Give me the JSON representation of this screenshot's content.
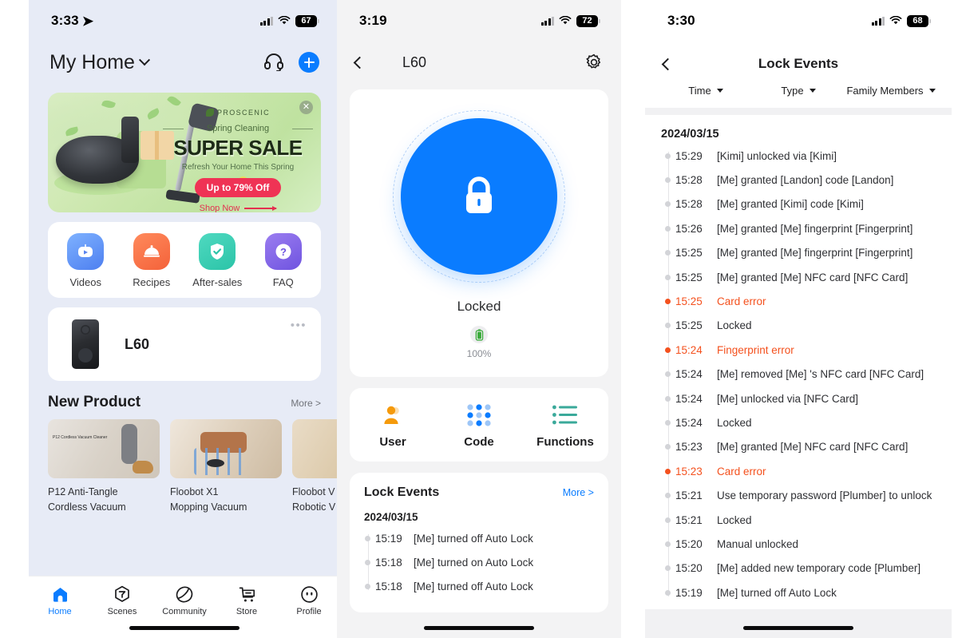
{
  "panel1": {
    "status": {
      "time": "3:33",
      "battery": "67",
      "location_icon": "location-arrow-icon",
      "wifi_icon": "wifi-icon",
      "signal_icon": "cellular-signal-icon"
    },
    "header": {
      "title": "My Home",
      "chevron_icon": "chevron-down-icon",
      "support_icon": "headset-icon",
      "add_icon": "plus-icon"
    },
    "banner": {
      "brand": "PROSCENIC",
      "eyebrow": "Spring Cleaning",
      "headline": "SUPER SALE",
      "tagline": "Refresh Your Home This Spring",
      "badge": "Up to 79% Off",
      "cta": "Shop Now",
      "close_icon": "close-icon"
    },
    "quick_actions": [
      {
        "label": "Videos",
        "icon": "play-video-icon"
      },
      {
        "label": "Recipes",
        "icon": "food-cover-icon"
      },
      {
        "label": "After-sales",
        "icon": "shield-check-icon"
      },
      {
        "label": "FAQ",
        "icon": "question-mark-icon"
      }
    ],
    "device": {
      "name": "L60",
      "more_icon": "more-dots-icon",
      "image": "smart-lock-image"
    },
    "new_product": {
      "title": "New Product",
      "more": "More >",
      "items": [
        {
          "name": "P12 Anti-Tangle\nCordless Vacuum",
          "caption": "P12 Cordless Vacuum Cleaner"
        },
        {
          "name": "Floobot X1\nMopping Vacuum",
          "caption": ""
        },
        {
          "name": "Floobot V\nRobotic V",
          "caption": ""
        }
      ]
    },
    "tabs": [
      {
        "label": "Home",
        "icon": "home-icon",
        "active": true
      },
      {
        "label": "Scenes",
        "icon": "scenes-icon",
        "active": false
      },
      {
        "label": "Community",
        "icon": "community-icon",
        "active": false
      },
      {
        "label": "Store",
        "icon": "cart-icon",
        "active": false
      },
      {
        "label": "Profile",
        "icon": "profile-icon",
        "active": false
      }
    ]
  },
  "panel2": {
    "status": {
      "time": "3:19",
      "battery": "72"
    },
    "header": {
      "title": "L60",
      "back_icon": "chevron-left-icon",
      "settings_icon": "gear-icon"
    },
    "lock": {
      "state": "Locked",
      "lock_icon": "padlock-closed-icon",
      "battery_percent": "100%",
      "battery_icon": "battery-full-icon"
    },
    "functions": [
      {
        "label": "User",
        "icon": "user-icon"
      },
      {
        "label": "Code",
        "icon": "keypad-dots-icon"
      },
      {
        "label": "Functions",
        "icon": "list-icon"
      }
    ],
    "events_card": {
      "title": "Lock Events",
      "more": "More >",
      "date": "2024/03/15",
      "rows": [
        {
          "time": "15:19",
          "text": "[Me] turned off Auto Lock",
          "error": false
        },
        {
          "time": "15:18",
          "text": "[Me] turned on Auto Lock",
          "error": false
        },
        {
          "time": "15:18",
          "text": "[Me] turned off Auto Lock",
          "error": false
        }
      ]
    }
  },
  "panel3": {
    "status": {
      "time": "3:30",
      "battery": "68"
    },
    "header": {
      "title": "Lock Events",
      "back_icon": "chevron-left-icon"
    },
    "filters": [
      {
        "label": "Time",
        "icon": "caret-down-icon"
      },
      {
        "label": "Type",
        "icon": "caret-down-icon"
      },
      {
        "label": "Family Members",
        "icon": "caret-down-icon"
      }
    ],
    "date": "2024/03/15",
    "events": [
      {
        "time": "15:29",
        "text": "[Kimi] unlocked via [Kimi]",
        "error": false
      },
      {
        "time": "15:28",
        "text": "[Me] granted [Landon] code [Landon]",
        "error": false
      },
      {
        "time": "15:28",
        "text": "[Me] granted [Kimi] code [Kimi]",
        "error": false
      },
      {
        "time": "15:26",
        "text": "[Me] granted [Me] fingerprint [Fingerprint]",
        "error": false
      },
      {
        "time": "15:25",
        "text": "[Me] granted [Me] fingerprint [Fingerprint]",
        "error": false
      },
      {
        "time": "15:25",
        "text": "[Me] granted [Me] NFC card [NFC Card]",
        "error": false
      },
      {
        "time": "15:25",
        "text": "Card error",
        "error": true
      },
      {
        "time": "15:25",
        "text": "Locked",
        "error": false
      },
      {
        "time": "15:24",
        "text": "Fingerprint error",
        "error": true
      },
      {
        "time": "15:24",
        "text": "[Me] removed [Me] 's NFC card [NFC Card]",
        "error": false
      },
      {
        "time": "15:24",
        "text": "[Me] unlocked via [NFC Card]",
        "error": false
      },
      {
        "time": "15:24",
        "text": "Locked",
        "error": false
      },
      {
        "time": "15:23",
        "text": "[Me] granted [Me] NFC card [NFC Card]",
        "error": false
      },
      {
        "time": "15:23",
        "text": "Card error",
        "error": true
      },
      {
        "time": "15:21",
        "text": "Use temporary password [Plumber] to unlock",
        "error": false
      },
      {
        "time": "15:21",
        "text": "Locked",
        "error": false
      },
      {
        "time": "15:20",
        "text": "Manual unlocked",
        "error": false
      },
      {
        "time": "15:20",
        "text": "[Me] added new temporary code [Plumber]",
        "error": false
      },
      {
        "time": "15:19",
        "text": "[Me] turned off Auto Lock",
        "error": false
      }
    ]
  },
  "colors": {
    "accent": "#0a7cff",
    "error": "#f4511e",
    "panel1_bg": "#e7ebf6",
    "panel2_bg": "#f3f3f4",
    "sale_badge": "#ef3355"
  }
}
